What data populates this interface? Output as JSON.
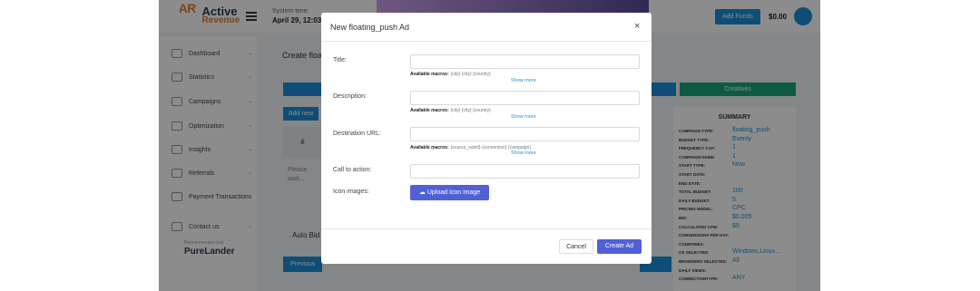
{
  "app": {
    "logo_top": "Active",
    "logo_bottom": "Revenue",
    "system_time_label": "System time:",
    "system_time_value": "April 29, 12:03",
    "add_funds_label": "Add Funds",
    "balance": "$0.00"
  },
  "sidebar": {
    "items": [
      {
        "label": "Dashboard"
      },
      {
        "label": "Statistics"
      },
      {
        "label": "Campaigns"
      },
      {
        "label": "Optimization"
      },
      {
        "label": "Insights"
      },
      {
        "label": "Referrals"
      },
      {
        "label": "Payment Transactions"
      },
      {
        "label": "Contact us"
      }
    ],
    "partner_caption": "Recommended tool",
    "partner_name": "PureLander"
  },
  "main": {
    "title": "Create floa",
    "tab_creatives": "Creatives",
    "add_new": "Add new",
    "col_hash": "#",
    "please_wait": "Please wait...",
    "auto_bid": "Auto Bid",
    "previous": "Previous"
  },
  "summary": {
    "title": "SUMMARY",
    "rows": [
      {
        "key": "CAMPAIGN TYPE:",
        "value": "floating_push"
      },
      {
        "key": "BUDGET TYPE:",
        "value": "Evenly"
      },
      {
        "key": "FREQUENCY CAP:",
        "value": "1"
      },
      {
        "key": "CAMPAIGN NAME:",
        "value": "1"
      },
      {
        "key": "START TYPE:",
        "value": "Now"
      },
      {
        "key": "START DATE:",
        "value": ""
      },
      {
        "key": "END DATE:",
        "value": ""
      },
      {
        "key": "TOTAL BUDGET:",
        "value": "100"
      },
      {
        "key": "DAILY BUDGET:",
        "value": "5"
      },
      {
        "key": "PRICING MODEL:",
        "value": "CPC"
      },
      {
        "key": "BID:",
        "value": "$0.005"
      },
      {
        "key": "CALCULATED CPM:",
        "value": "$5"
      },
      {
        "key": "CONVERSIONS PER DAY:",
        "value": ""
      },
      {
        "key": "COUNTRIES:",
        "value": ""
      },
      {
        "key": "OS SELECTED:",
        "value": "Windows,Linux..."
      },
      {
        "key": "BROWSERS SELECTED:",
        "value": "All"
      },
      {
        "key": "DAILY VIEWS:",
        "value": ""
      },
      {
        "key": "CONNECTIONTYPE:",
        "value": "ANY"
      }
    ]
  },
  "modal": {
    "title": "New floating_push Ad",
    "close": "×",
    "fields": {
      "title_label": "Title:",
      "title_value": "",
      "title_macros_label": "Available macros:",
      "title_macros": "{city} {city} {country}",
      "description_label": "Description:",
      "description_value": "",
      "description_macros_label": "Available macros:",
      "description_macros": "{city} {city} {country}",
      "url_label": "Destination URL:",
      "url_value": "",
      "url_macros_label": "Available macros:",
      "url_macros": "{source_subid} {conversion} {campaign}",
      "cta_label": "Call to action:",
      "cta_value": "",
      "icon_label": "Icon images:",
      "upload_label": "Upload Icon image"
    },
    "show_more": "Show more",
    "cancel": "Cancel",
    "create": "Create Ad"
  },
  "colors": {
    "accent": "#5160d6",
    "link": "#1a8fd8",
    "brand_orange": "#e07b2e"
  }
}
